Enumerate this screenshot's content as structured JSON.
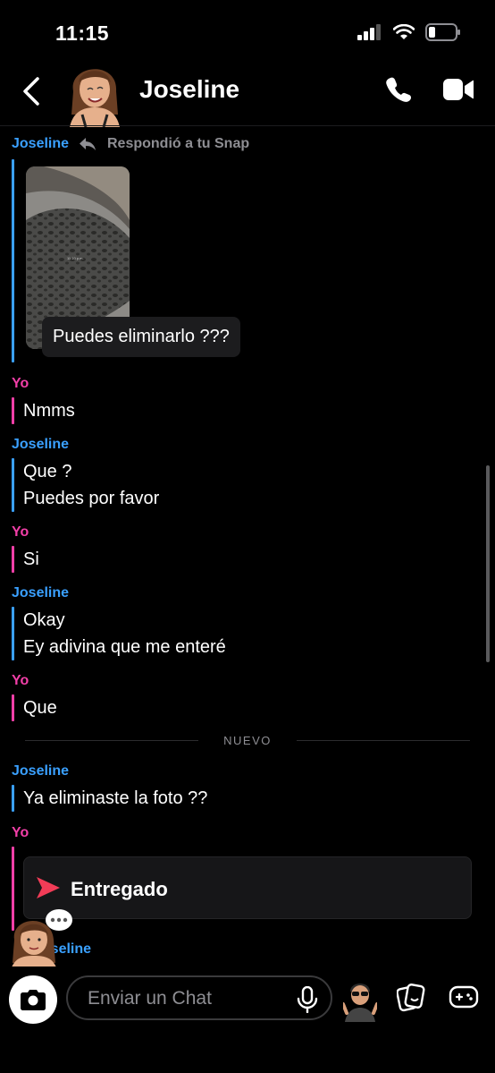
{
  "status_bar": {
    "time": "11:15"
  },
  "header": {
    "contact_name": "Joseline"
  },
  "replied_note": {
    "sender": "Joseline",
    "text": "Respondió a tu Snap"
  },
  "snap_caption": "Puedes eliminarlo ???",
  "snap_timestamp": "11:10 p.m.",
  "messages": [
    {
      "sender": "Yo",
      "lines": [
        "Nmms"
      ]
    },
    {
      "sender": "Joseline",
      "lines": [
        "Que ?",
        "Puedes por favor"
      ]
    },
    {
      "sender": "Yo",
      "lines": [
        "Si"
      ]
    },
    {
      "sender": "Joseline",
      "lines": [
        "Okay",
        "Ey adivina que me enteré"
      ]
    },
    {
      "sender": "Yo",
      "lines": [
        "Que"
      ]
    },
    {
      "sender": "Joseline",
      "lines": [
        "Ya eliminaste la foto ??"
      ]
    },
    {
      "sender": "Yo",
      "lines": []
    }
  ],
  "new_divider": "NUEVO",
  "delivered_status": "Entregado",
  "peek_sender": "Joseline",
  "input": {
    "placeholder": "Enviar un Chat"
  },
  "colors": {
    "joseline": "#3aa0ff",
    "yo": "#f23fa8",
    "delivered_arrow": "#f23c57"
  },
  "icons": [
    "back-chevron-icon",
    "phone-icon",
    "video-icon",
    "reply-icon",
    "camera-icon",
    "mic-icon",
    "sticker-icon",
    "games-icon"
  ]
}
